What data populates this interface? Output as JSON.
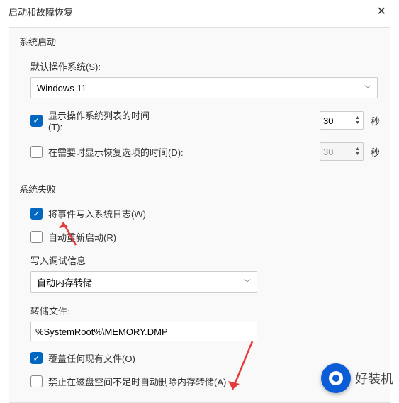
{
  "window": {
    "title": "启动和故障恢复"
  },
  "startup": {
    "group_title": "系统启动",
    "default_os_label": "默认操作系统(S):",
    "default_os_value": "Windows 11",
    "show_os_list_label": "显示操作系统列表的时间(T):",
    "show_os_list_value": "30",
    "show_recovery_label": "在需要时显示恢复选项的时间(D):",
    "show_recovery_value": "30",
    "seconds_unit": "秒"
  },
  "failure": {
    "group_title": "系统失败",
    "write_log_label": "将事件写入系统日志(W)",
    "auto_restart_label": "自动重新启动(R)",
    "debug_info_label": "写入调试信息",
    "debug_info_value": "自动内存转储",
    "dump_file_label": "转储文件:",
    "dump_file_value": "%SystemRoot%\\MEMORY.DMP",
    "overwrite_label": "覆盖任何现有文件(O)",
    "disable_autodel_label": "禁止在磁盘空间不足时自动删除内存转储(A)"
  },
  "watermark": {
    "text": "好装机"
  }
}
